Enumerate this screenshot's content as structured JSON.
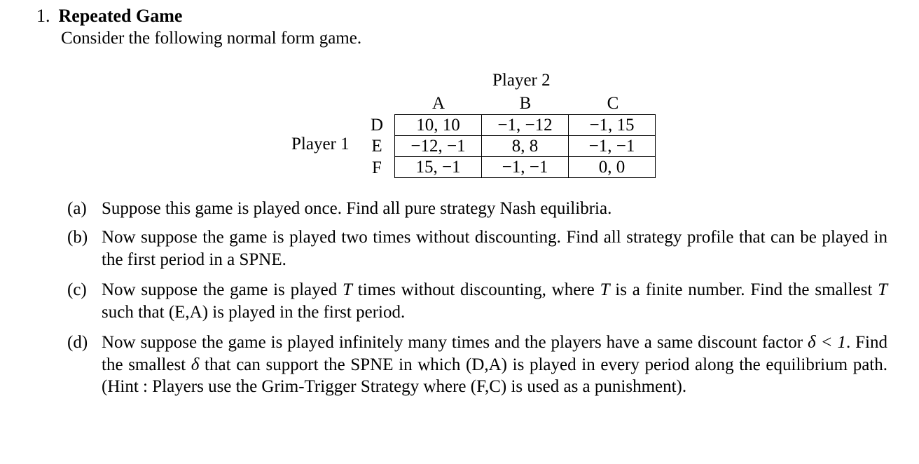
{
  "heading": {
    "number": "1.",
    "title": "Repeated Game"
  },
  "intro": "Consider the following normal form game.",
  "game": {
    "player2_label": "Player 2",
    "player1_label": "Player 1",
    "columns": [
      "A",
      "B",
      "C"
    ],
    "rows": [
      "D",
      "E",
      "F"
    ],
    "payoffs": [
      [
        "10, 10",
        "−1, −12",
        "−1, 15"
      ],
      [
        "−12, −1",
        "8, 8",
        "−1, −1"
      ],
      [
        "15, −1",
        "−1, −1",
        "0, 0"
      ]
    ]
  },
  "questions": [
    {
      "label": "(a)",
      "text": "Suppose this game is played once. Find all pure strategy Nash equilibria."
    },
    {
      "label": "(b)",
      "text": "Now suppose the game is played two times without discounting. Find all strategy profile that can be played in the first period in a SPNE."
    },
    {
      "label": "(c)",
      "text_parts": [
        "Now suppose the game is played ",
        "T",
        " times without discounting, where ",
        "T",
        " is a finite number. Find the smallest ",
        "T",
        " such that (E,A) is played in the first period."
      ]
    },
    {
      "label": "(d)",
      "text_parts": [
        "Now suppose the game is played infinitely many times and the players have a same discount factor ",
        "δ < 1",
        ". Find the smallest ",
        "δ",
        " that can support the SPNE in which (D,A) is played in every period along the equilibrium path. (Hint : Players use the Grim-Trigger Strategy where (F,C) is used as a punishment)."
      ]
    }
  ]
}
